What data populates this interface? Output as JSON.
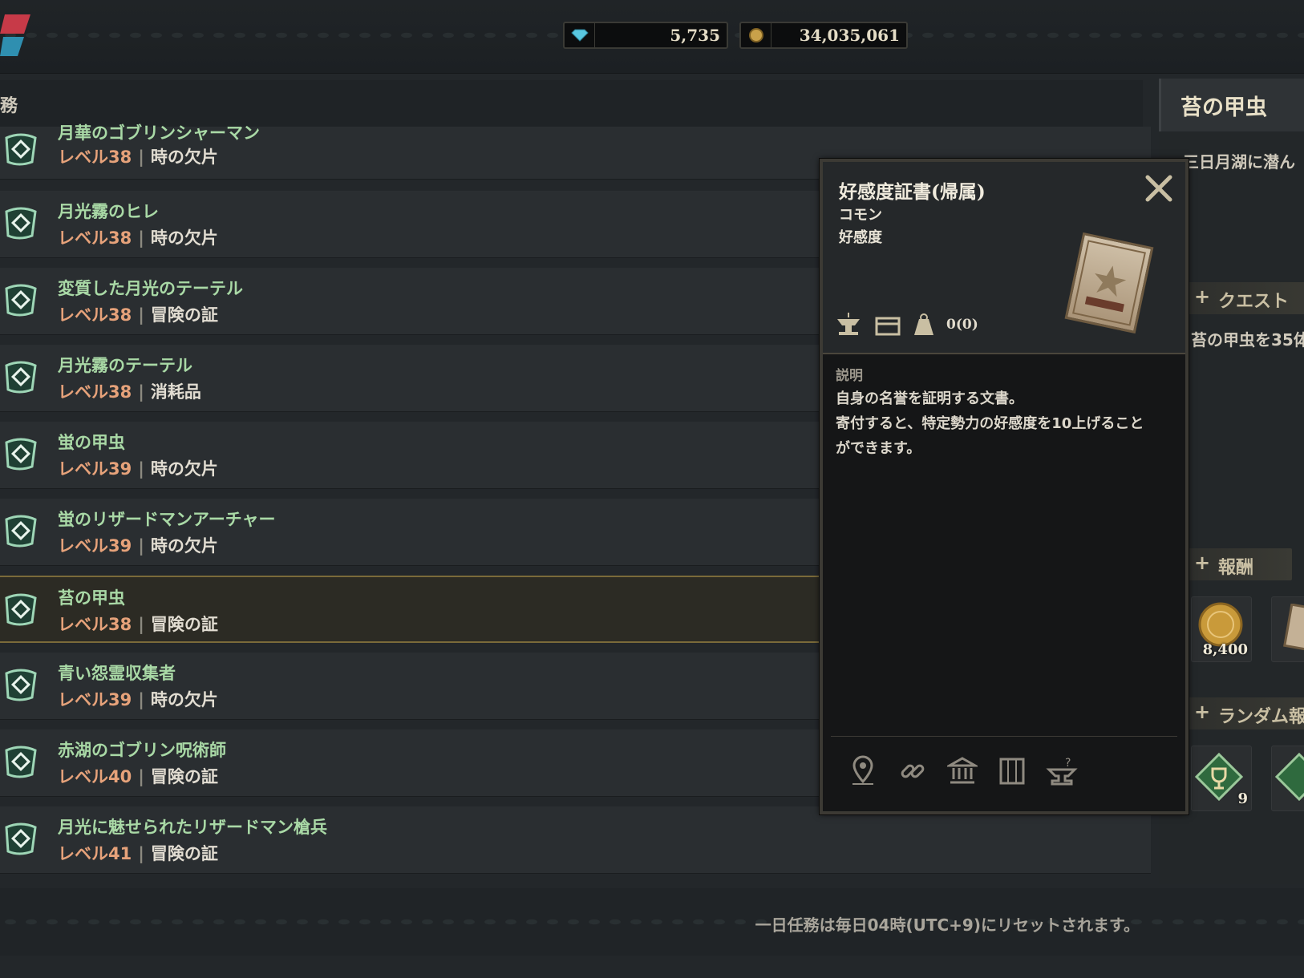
{
  "currencies": [
    {
      "icon": "diamond-icon",
      "value": "5,735"
    },
    {
      "icon": "gold-coin-icon",
      "value": "34,035,061"
    }
  ],
  "header": {
    "label": "務"
  },
  "quests": [
    {
      "title": "月華のゴブリンシャーマン",
      "level": "レベル38",
      "category": "時の欠片"
    },
    {
      "title": "月光霧のヒレ",
      "level": "レベル38",
      "category": "時の欠片"
    },
    {
      "title": "変質した月光のテーテル",
      "level": "レベル38",
      "category": "冒険の証"
    },
    {
      "title": "月光霧のテーテル",
      "level": "レベル38",
      "category": "消耗品"
    },
    {
      "title": "蛍の甲虫",
      "level": "レベル39",
      "category": "時の欠片"
    },
    {
      "title": "蛍のリザードマンアーチャー",
      "level": "レベル39",
      "category": "時の欠片"
    },
    {
      "title": "苔の甲虫",
      "level": "レベル38",
      "category": "冒険の証",
      "selected": true
    },
    {
      "title": "青い怨霊収集者",
      "level": "レベル39",
      "category": "時の欠片"
    },
    {
      "title": "赤湖のゴブリン呪術師",
      "level": "レベル40",
      "category": "冒険の証"
    },
    {
      "title": "月光に魅せられたリザードマン槍兵",
      "level": "レベル41",
      "category": "冒険の証"
    }
  ],
  "footer": {
    "note": "一日任務は毎日04時(UTC+9)にリセットされます。"
  },
  "detail": {
    "title": "苔の甲虫",
    "description": "三日月湖に潜ん",
    "quest_header": "クエスト",
    "quest_text": "苔の甲虫を35体",
    "reward_header": "報酬",
    "reward_gold": "8,400",
    "random_header": "ランダム報",
    "random_count": "9"
  },
  "tooltip": {
    "name": "好感度証書(帰属)",
    "rarity": "コモン",
    "type": "好感度",
    "stat_value": "0(0)",
    "section_label": "説明",
    "description_lines": [
      "自身の名誉を証明する文書。",
      "寄付すると、特定勢力の好感度を10上げること",
      "ができます。"
    ],
    "footer_icons": [
      "map-pin-icon",
      "link-icon",
      "bank-icon",
      "storage-icon",
      "anvil-icon"
    ]
  },
  "colors": {
    "quest_title": "#a9d9a6",
    "level": "#e6a27a",
    "selected_border": "#7a6a3a"
  }
}
